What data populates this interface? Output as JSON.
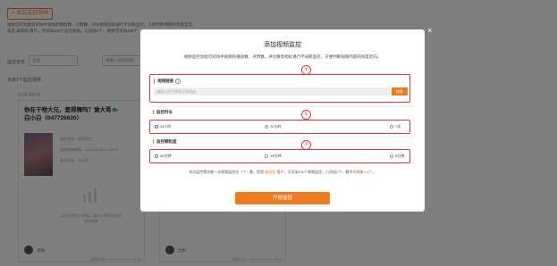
{
  "background": {
    "add_button": "+ 添加监控视频",
    "intro_line1": "视频监控功能可对快手视频的播放数、点赞数、评论数等指标进行不间断监控，方便判断视频的热度走向。",
    "intro_line2": "您是 兼容图 用户，可添加200个监控视频，已添加2个，剩余可添加198个",
    "filter_label": "监控状态",
    "filter_value": "全部",
    "search_placeholder": "请输入视频标题",
    "count_text": "共有2个监控视频",
    "date_label": "2021-03-03",
    "card1": {
      "title": "你在干啥大兄，是得舞吗？谁大哥🐟白小白（047726630）",
      "meta1": "监控状态：暂时监控",
      "meta2": "监控开始时间：2021-03-03 11:24:08",
      "meta3": "监控时长：24小时",
      "empty_tip": "监控结果暂无数据，请耐心等待监控结果的更新",
      "username": "太阳",
      "create_time": "创建时间：2021-03-03 11:24:08"
    },
    "card2": {
      "username": "太阳",
      "create_time": "创建时间：2021-03-03 11:24:08"
    }
  },
  "modal": {
    "title": "添加视频监控",
    "description": "视频监控功能可对快手视频的播放数、点赞数、评论数等指标进行不间断监控，方便判断视频内容的热度走向。",
    "close_icon": "×",
    "section1": {
      "mark": "①",
      "label": "视频链接",
      "help_icon": "?",
      "input_placeholder": "请输入快手视频分享链接",
      "button": "搜索"
    },
    "section2": {
      "mark": "②",
      "label": "监控时长",
      "options": [
        "24小时",
        "72小时",
        "7天"
      ],
      "selected": "24小时"
    },
    "section3": {
      "mark": "③",
      "label": "监控颗粒度",
      "options": [
        "30分钟",
        "15分钟",
        "5分钟"
      ],
      "selected": "30分钟"
    },
    "note_prefix": "本次监控需消耗一次视频监控次（个）数，您是 ",
    "note_highlight1": "兼容版",
    "note_middle": " 用户，可添加200个视频监控，已添加2个，剩余可添加",
    "note_highlight2": "198个",
    "note_suffix": "。",
    "start_button": "开始监控"
  },
  "colors": {
    "accent": "#f07b1f",
    "annotation_red": "#e33",
    "radio_selected": "#1e7be0"
  }
}
